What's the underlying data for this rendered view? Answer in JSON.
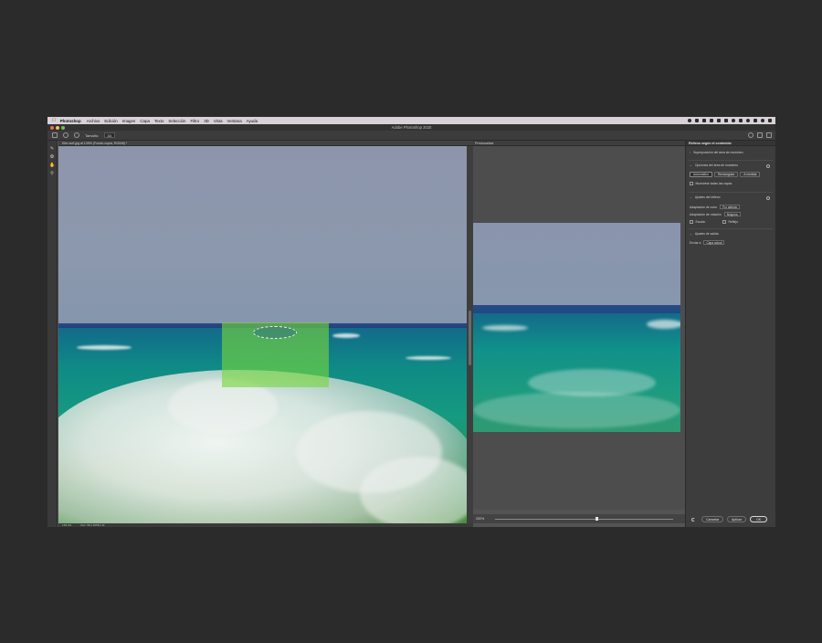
{
  "menubar": {
    "app_name": "Photoshop",
    "items": [
      "Archivo",
      "Edición",
      "Imagen",
      "Capa",
      "Texto",
      "Selección",
      "Filtro",
      "3D",
      "Vista",
      "Ventana",
      "Ayuda"
    ]
  },
  "window": {
    "title": "Adobe Photoshop 2020"
  },
  "options": {
    "size_label": "Tamaño:",
    "size_value": "34"
  },
  "document": {
    "tab_title": "Kite surf.jpg al 139% (Fondo copia, RGB/8) *",
    "zoom": "138,4%",
    "doc_info": "Doc: 58,1 M/58,1 M"
  },
  "preview": {
    "title": "Previsualizar",
    "zoom": "250%"
  },
  "panel": {
    "title": "Relleno según el contenido",
    "overlay_section": "Superposición del área de muestreo",
    "sampling_section": "Opciones del área de muestreo",
    "buttons": {
      "auto": "Automático",
      "rect": "Rectangular",
      "custom": "A medida"
    },
    "show_all_layers": "Muestrear todas las capas",
    "fill_section": "Ajustes del relleno",
    "color_adaptation_label": "Adaptación de color",
    "color_adaptation_value": "Por defecto",
    "rotation_label": "Adaptación de rotación",
    "rotation_value": "Ninguna",
    "scale_label": "Escala",
    "mirror_label": "Reflejo",
    "output_section": "Ajustes de salida",
    "output_label": "Enviar a",
    "output_value": "Capa actual"
  },
  "footer": {
    "cancel": "Cancelar",
    "apply": "Aplicar",
    "ok": "OK"
  }
}
